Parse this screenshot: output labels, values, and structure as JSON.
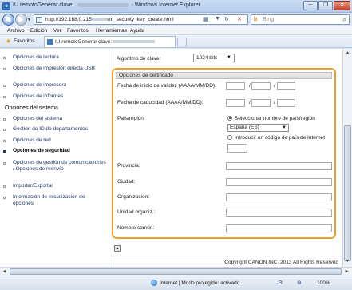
{
  "window": {
    "title_prefix": "IU remotoGenerar clave:",
    "title_suffix": "- Windows Internet Explorer",
    "minimize": "─",
    "restore": "❐",
    "close": "✕"
  },
  "nav": {
    "back": "◀",
    "forward": "▶",
    "dropdown": "▼",
    "url_host": "http://192.168.0.215",
    "url_path": "/m_security_key_create.html",
    "compat_icon": "compat-view-icon",
    "refresh": "↻",
    "stop": "✕",
    "search_engine": "Bing",
    "search_glyph": "b",
    "search_btn": "⌕"
  },
  "menu": [
    "Archivo",
    "Edición",
    "Ver",
    "Favoritos",
    "Herramientas",
    "Ayuda"
  ],
  "favbar": {
    "favorites_label": "Favoritos",
    "tab_title": "IU remotoGenerar clave:"
  },
  "sidebar": {
    "items_top": [
      {
        "label": "Opciones de lectura"
      },
      {
        "label": "Opciones de impresión directa USB"
      },
      {
        "label": "Opciones de impresora"
      },
      {
        "label": "Opciones de informes"
      }
    ],
    "section_header": "Opciones del sistema",
    "items_system": [
      {
        "label": "Opciones del sistema",
        "active": false
      },
      {
        "label": "Gestión de ID de departamentos",
        "active": false
      },
      {
        "label": "Opciones de red",
        "active": false
      },
      {
        "label": "Opciones de seguridad",
        "active": true
      },
      {
        "label": "Opciones de gestión de comunicaciones / Opciones de reenvío",
        "active": false
      },
      {
        "label": "Importar/Exportar",
        "active": false
      },
      {
        "label": "Información de inicialización de opciones",
        "active": false
      }
    ]
  },
  "main": {
    "algorithm_label": "Algoritmo de clave:",
    "algorithm_value": "1024 bits",
    "cert_header": "Opciones de certificado",
    "valid_from_label": "Fecha de inicio de validez (AAAA/MM/DD):",
    "valid_to_label": "Fecha de caducidad (AAAA/MM/DD):",
    "date_sep": "/",
    "country_label": "País/región:",
    "radio_select_label": "Seleccionar nombre de país/región",
    "country_value": "España (ES)",
    "radio_code_label": "Introducir un código de país de Internet",
    "province_label": "Provincia:",
    "city_label": "Ciudad:",
    "org_label": "Organización:",
    "org_unit_label": "Unidad organiz.:",
    "common_name_label": "Nombre común:",
    "copyright": "Copyright CANON INC. 2013 All Rights Reserved"
  },
  "status": {
    "zone": "Internet | Modo protegido: activado",
    "zoom": "100%"
  }
}
